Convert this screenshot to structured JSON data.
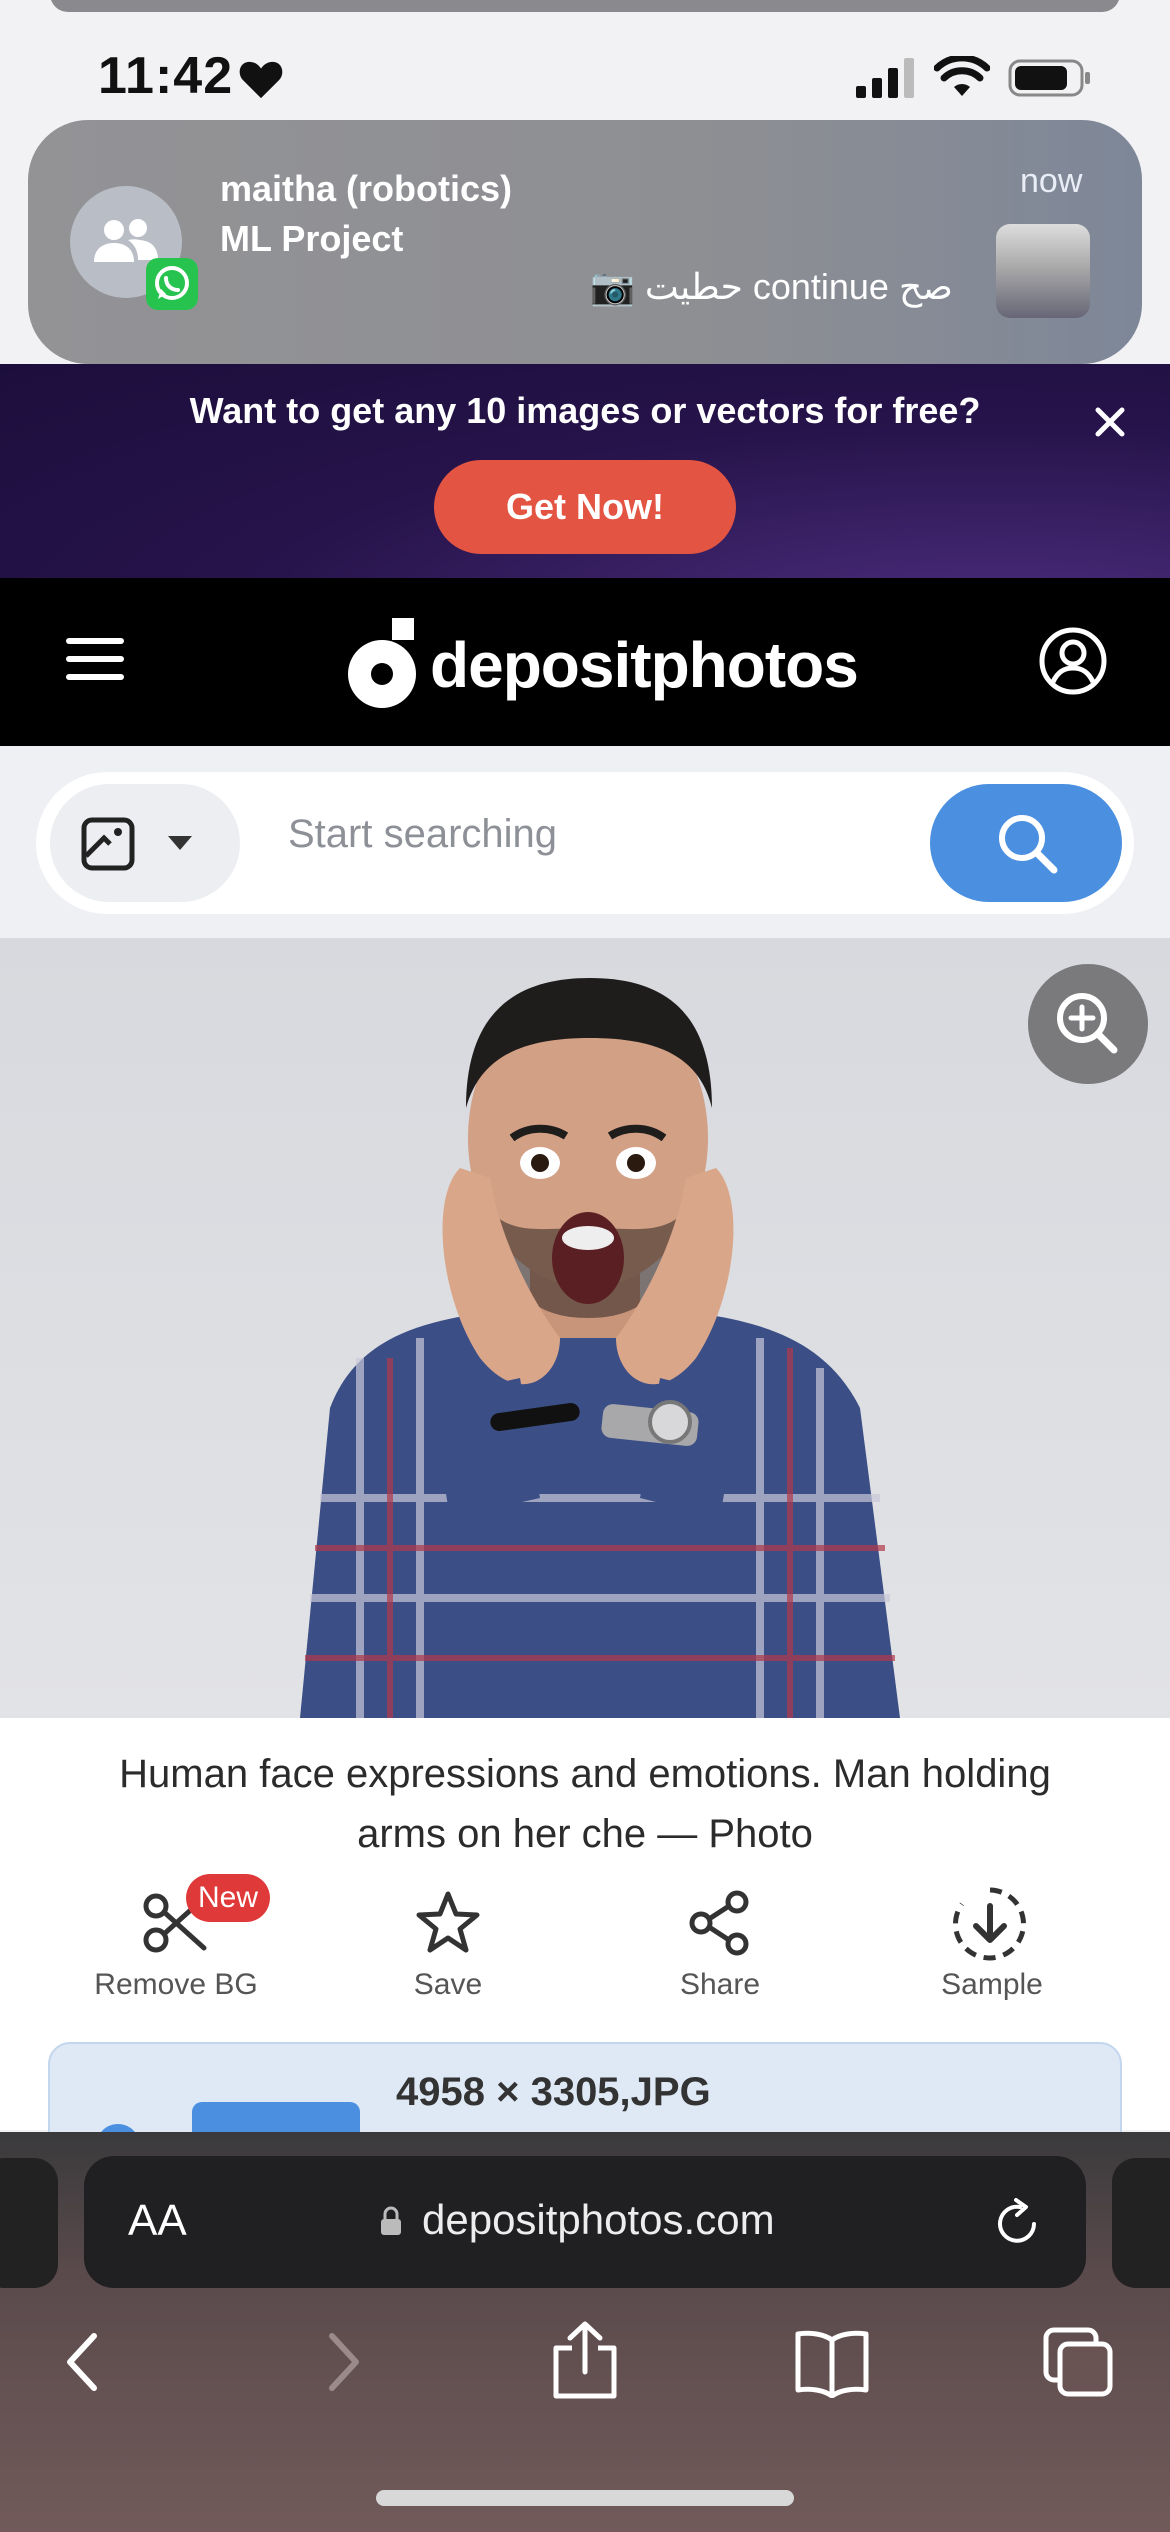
{
  "status_bar": {
    "time": "11:42",
    "icons": [
      "heart-icon",
      "signal-icon",
      "wifi-icon",
      "battery-icon"
    ]
  },
  "notification": {
    "app": "WhatsApp",
    "title": "maitha (robotics)",
    "subtitle": "ML Project",
    "body": "📷 حطيت continue صح",
    "time": "now"
  },
  "promo": {
    "text": "Want to get any 10 images or vectors for free?",
    "button": "Get Now!",
    "close_icon": "close-icon"
  },
  "header": {
    "logo_text": "depositphotos",
    "menu_icon": "menu-icon",
    "account_icon": "user-circle-icon"
  },
  "search": {
    "placeholder": "Start searching",
    "type_icon": "image-type-icon",
    "button_icon": "search-icon"
  },
  "photo": {
    "zoom_icon": "zoom-in-icon"
  },
  "item": {
    "caption": "Human face expressions and emotions. Man holding arms on her che — Photo",
    "actions": [
      {
        "label": "Remove BG",
        "icon": "scissors-icon",
        "badge": "New"
      },
      {
        "label": "Save",
        "icon": "star-icon"
      },
      {
        "label": "Share",
        "icon": "share-icon"
      },
      {
        "label": "Sample",
        "icon": "download-icon"
      }
    ],
    "dimensions": "4958 × 3305,JPG"
  },
  "browser": {
    "text_size_label": "AA",
    "url": "depositphotos.com",
    "toolbar_icons": [
      "back-icon",
      "forward-icon",
      "share-icon",
      "bookmarks-icon",
      "tabs-icon"
    ]
  },
  "colors": {
    "accent_blue": "#4a8fe0",
    "promo_red": "#e35542",
    "promo_bg": "#1c0e3c",
    "header_bg": "#000000",
    "badge_red": "#e0393a"
  }
}
